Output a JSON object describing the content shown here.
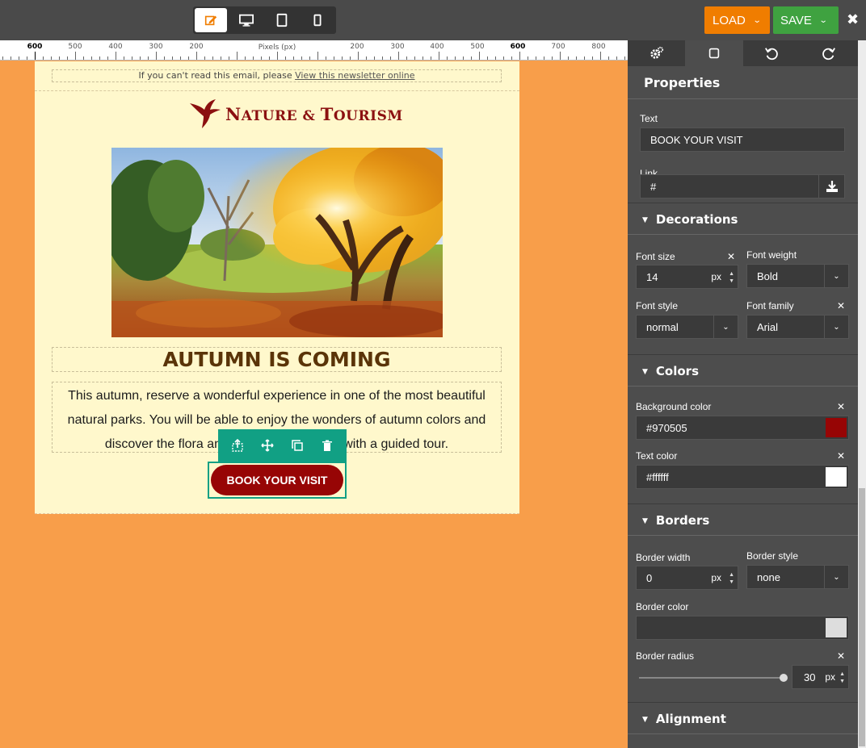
{
  "toolbar": {
    "load_label": "LOAD",
    "save_label": "SAVE",
    "close_label": "✖",
    "modes": [
      "edit-mode",
      "desktop-preview",
      "tablet-preview",
      "mobile-preview"
    ]
  },
  "ruler": {
    "center_label": "Pixels (px)",
    "labels": [
      "600",
      "500",
      "400",
      "300",
      "200",
      "200",
      "300",
      "400",
      "500",
      "600",
      "700",
      "800"
    ]
  },
  "email": {
    "preheader_text": "If you can't read this email, please ",
    "preheader_link": "View this newsletter online",
    "logo_text_1": "N",
    "logo_text_2": "ATURE & ",
    "logo_text_3": "T",
    "logo_text_4": "OURISM",
    "heading": "AUTUMN IS COMING",
    "body": "This autumn, reserve a wonderful experience in one of the most beautiful natural parks. You will be able to enjoy the wonders of autumn colors and discover the flora and fauna of the region with a guided tour.",
    "button_label": "BOOK YOUR VISIT"
  },
  "block_toolbar": [
    "upload-icon",
    "move-icon",
    "duplicate-icon",
    "trash-icon"
  ],
  "panel": {
    "tabs": [
      "gear-icon",
      "square-icon",
      "undo-icon",
      "redo-icon"
    ],
    "title": "Properties",
    "text_label": "Text",
    "text_value": "BOOK YOUR VISIT",
    "link_label": "Link",
    "link_value": "#",
    "decorations_title": "Decorations",
    "font_size_label": "Font size",
    "font_size_value": "14",
    "unit_px": "px",
    "font_weight_label": "Font weight",
    "font_weight_value": "Bold",
    "font_style_label": "Font style",
    "font_style_value": "normal",
    "font_family_label": "Font family",
    "font_family_value": "Arial",
    "colors_title": "Colors",
    "bg_color_label": "Background color",
    "bg_color_value": "#970505",
    "text_color_label": "Text color",
    "text_color_value": "#ffffff",
    "borders_title": "Borders",
    "border_width_label": "Border width",
    "border_width_value": "0",
    "border_style_label": "Border style",
    "border_style_value": "none",
    "border_color_label": "Border color",
    "border_color_value": "",
    "border_radius_label": "Border radius",
    "border_radius_value": "30",
    "alignment_title": "Alignment"
  },
  "colors": {
    "accent_teal": "#11a084",
    "load": "#f07d00",
    "save": "#3fa240",
    "canvas_bg": "#f89e4a",
    "cta": "#970505"
  }
}
